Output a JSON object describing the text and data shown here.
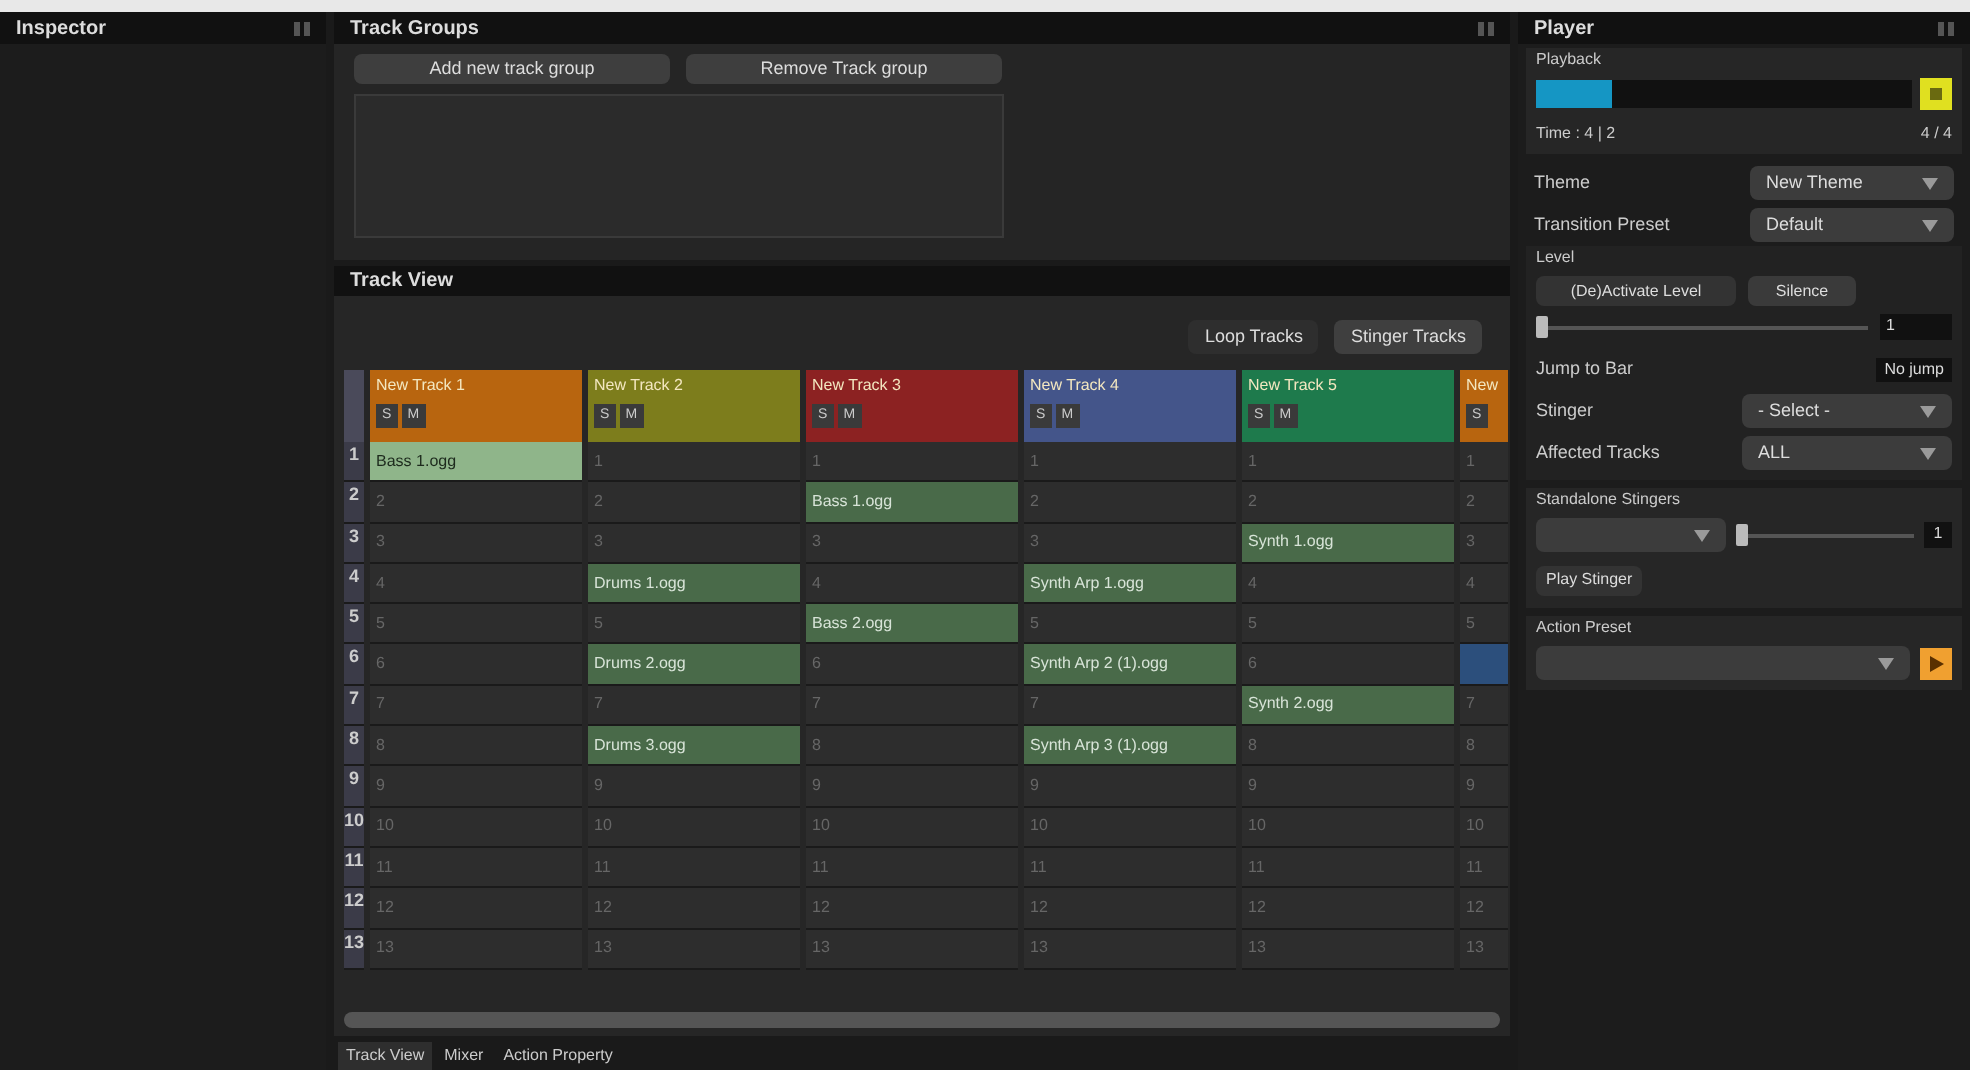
{
  "inspector": {
    "title": "Inspector"
  },
  "track_groups": {
    "title": "Track Groups",
    "buttons": [
      "Add new track group",
      "Remove Track group"
    ]
  },
  "track_view": {
    "title": "Track View",
    "toggles": [
      {
        "label": "Loop Tracks",
        "selected": false
      },
      {
        "label": "Stinger Tracks",
        "selected": true
      }
    ],
    "row_numbers": [
      "1",
      "2",
      "3",
      "4",
      "5",
      "6",
      "7",
      "8",
      "9",
      "10",
      "11",
      "12",
      "13"
    ],
    "tracks": [
      {
        "name": "New Track 1",
        "color": "#b8650f",
        "buttons": [
          "S",
          "M"
        ],
        "cells": [
          {
            "kind": "playing",
            "text": "Bass 1.ogg"
          },
          {
            "kind": "empty",
            "text": "2"
          },
          {
            "kind": "empty",
            "text": "3"
          },
          {
            "kind": "empty",
            "text": "4"
          },
          {
            "kind": "empty",
            "text": "5"
          },
          {
            "kind": "empty",
            "text": "6"
          },
          {
            "kind": "empty",
            "text": "7"
          },
          {
            "kind": "empty",
            "text": "8"
          },
          {
            "kind": "empty",
            "text": "9"
          },
          {
            "kind": "empty",
            "text": "10"
          },
          {
            "kind": "empty",
            "text": "11"
          },
          {
            "kind": "empty",
            "text": "12"
          },
          {
            "kind": "empty",
            "text": "13"
          }
        ]
      },
      {
        "name": "New Track 2",
        "color": "#7d7d1c",
        "buttons": [
          "S",
          "M"
        ],
        "cells": [
          {
            "kind": "empty",
            "text": "1"
          },
          {
            "kind": "empty",
            "text": "2"
          },
          {
            "kind": "empty",
            "text": "3"
          },
          {
            "kind": "clip",
            "text": "Drums 1.ogg"
          },
          {
            "kind": "empty",
            "text": "5"
          },
          {
            "kind": "clip",
            "text": "Drums 2.ogg"
          },
          {
            "kind": "empty",
            "text": "7"
          },
          {
            "kind": "clip",
            "text": "Drums 3.ogg"
          },
          {
            "kind": "empty",
            "text": "9"
          },
          {
            "kind": "empty",
            "text": "10"
          },
          {
            "kind": "empty",
            "text": "11"
          },
          {
            "kind": "empty",
            "text": "12"
          },
          {
            "kind": "empty",
            "text": "13"
          }
        ]
      },
      {
        "name": "New Track 3",
        "color": "#8c2222",
        "buttons": [
          "S",
          "M"
        ],
        "cells": [
          {
            "kind": "empty",
            "text": "1"
          },
          {
            "kind": "clip",
            "text": "Bass 1.ogg"
          },
          {
            "kind": "empty",
            "text": "3"
          },
          {
            "kind": "empty",
            "text": "4"
          },
          {
            "kind": "clip",
            "text": "Bass 2.ogg"
          },
          {
            "kind": "empty",
            "text": "6"
          },
          {
            "kind": "empty",
            "text": "7"
          },
          {
            "kind": "empty",
            "text": "8"
          },
          {
            "kind": "empty",
            "text": "9"
          },
          {
            "kind": "empty",
            "text": "10"
          },
          {
            "kind": "empty",
            "text": "11"
          },
          {
            "kind": "empty",
            "text": "12"
          },
          {
            "kind": "empty",
            "text": "13"
          }
        ]
      },
      {
        "name": "New Track 4",
        "color": "#44558a",
        "buttons": [
          "S",
          "M"
        ],
        "cells": [
          {
            "kind": "empty",
            "text": "1"
          },
          {
            "kind": "empty",
            "text": "2"
          },
          {
            "kind": "empty",
            "text": "3"
          },
          {
            "kind": "clip",
            "text": "Synth Arp 1.ogg"
          },
          {
            "kind": "empty",
            "text": "5"
          },
          {
            "kind": "clip",
            "text": "Synth Arp 2 (1).ogg"
          },
          {
            "kind": "empty",
            "text": "7"
          },
          {
            "kind": "clip",
            "text": "Synth Arp 3 (1).ogg"
          },
          {
            "kind": "empty",
            "text": "9"
          },
          {
            "kind": "empty",
            "text": "10"
          },
          {
            "kind": "empty",
            "text": "11"
          },
          {
            "kind": "empty",
            "text": "12"
          },
          {
            "kind": "empty",
            "text": "13"
          }
        ]
      },
      {
        "name": "New Track 5",
        "color": "#1e7a4c",
        "buttons": [
          "S",
          "M"
        ],
        "cells": [
          {
            "kind": "empty",
            "text": "1"
          },
          {
            "kind": "empty",
            "text": "2"
          },
          {
            "kind": "clip",
            "text": "Synth 1.ogg"
          },
          {
            "kind": "empty",
            "text": "4"
          },
          {
            "kind": "empty",
            "text": "5"
          },
          {
            "kind": "empty",
            "text": "6"
          },
          {
            "kind": "clip",
            "text": "Synth 2.ogg"
          },
          {
            "kind": "empty",
            "text": "8"
          },
          {
            "kind": "empty",
            "text": "9"
          },
          {
            "kind": "empty",
            "text": "10"
          },
          {
            "kind": "empty",
            "text": "11"
          },
          {
            "kind": "empty",
            "text": "12"
          },
          {
            "kind": "empty",
            "text": "13"
          }
        ]
      },
      {
        "name": "New",
        "color": "#b8650f",
        "buttons": [
          "S"
        ],
        "cells": [
          {
            "kind": "empty",
            "text": "1"
          },
          {
            "kind": "empty",
            "text": "2"
          },
          {
            "kind": "empty",
            "text": "3"
          },
          {
            "kind": "empty",
            "text": "4"
          },
          {
            "kind": "empty",
            "text": "5"
          },
          {
            "kind": "highlight"
          },
          {
            "kind": "empty",
            "text": "7"
          },
          {
            "kind": "empty",
            "text": "8"
          },
          {
            "kind": "empty",
            "text": "9"
          },
          {
            "kind": "empty",
            "text": "10"
          },
          {
            "kind": "empty",
            "text": "11"
          },
          {
            "kind": "empty",
            "text": "12"
          },
          {
            "kind": "empty",
            "text": "13"
          }
        ]
      }
    ]
  },
  "bottom_tabs": [
    {
      "label": "Track View",
      "selected": true
    },
    {
      "label": "Mixer",
      "selected": false
    },
    {
      "label": "Action Property",
      "selected": false
    }
  ],
  "player": {
    "title": "Player",
    "playback": {
      "title": "Playback",
      "level": 0.2,
      "time": "Time : 4 | 2",
      "signature": "4 / 4"
    },
    "theme": {
      "label": "Theme",
      "value": "New Theme"
    },
    "transition": {
      "label": "Transition Preset",
      "value": "Default"
    },
    "level_group": {
      "title": "Level",
      "button": "(De)Activate Level",
      "silence": "Silence",
      "level": 0.0,
      "value": "1"
    },
    "jump": {
      "label": "Jump to Bar",
      "value": "No jump"
    },
    "stinger": {
      "label": "Stinger",
      "value": "- Select -"
    },
    "affected": {
      "label": "Affected Tracks",
      "value": "ALL"
    },
    "standalone": {
      "title": "Standalone Stingers",
      "level": 0.0,
      "value": "1",
      "button": "Play Stinger"
    },
    "action_preset": {
      "title": "Action Preset"
    }
  }
}
